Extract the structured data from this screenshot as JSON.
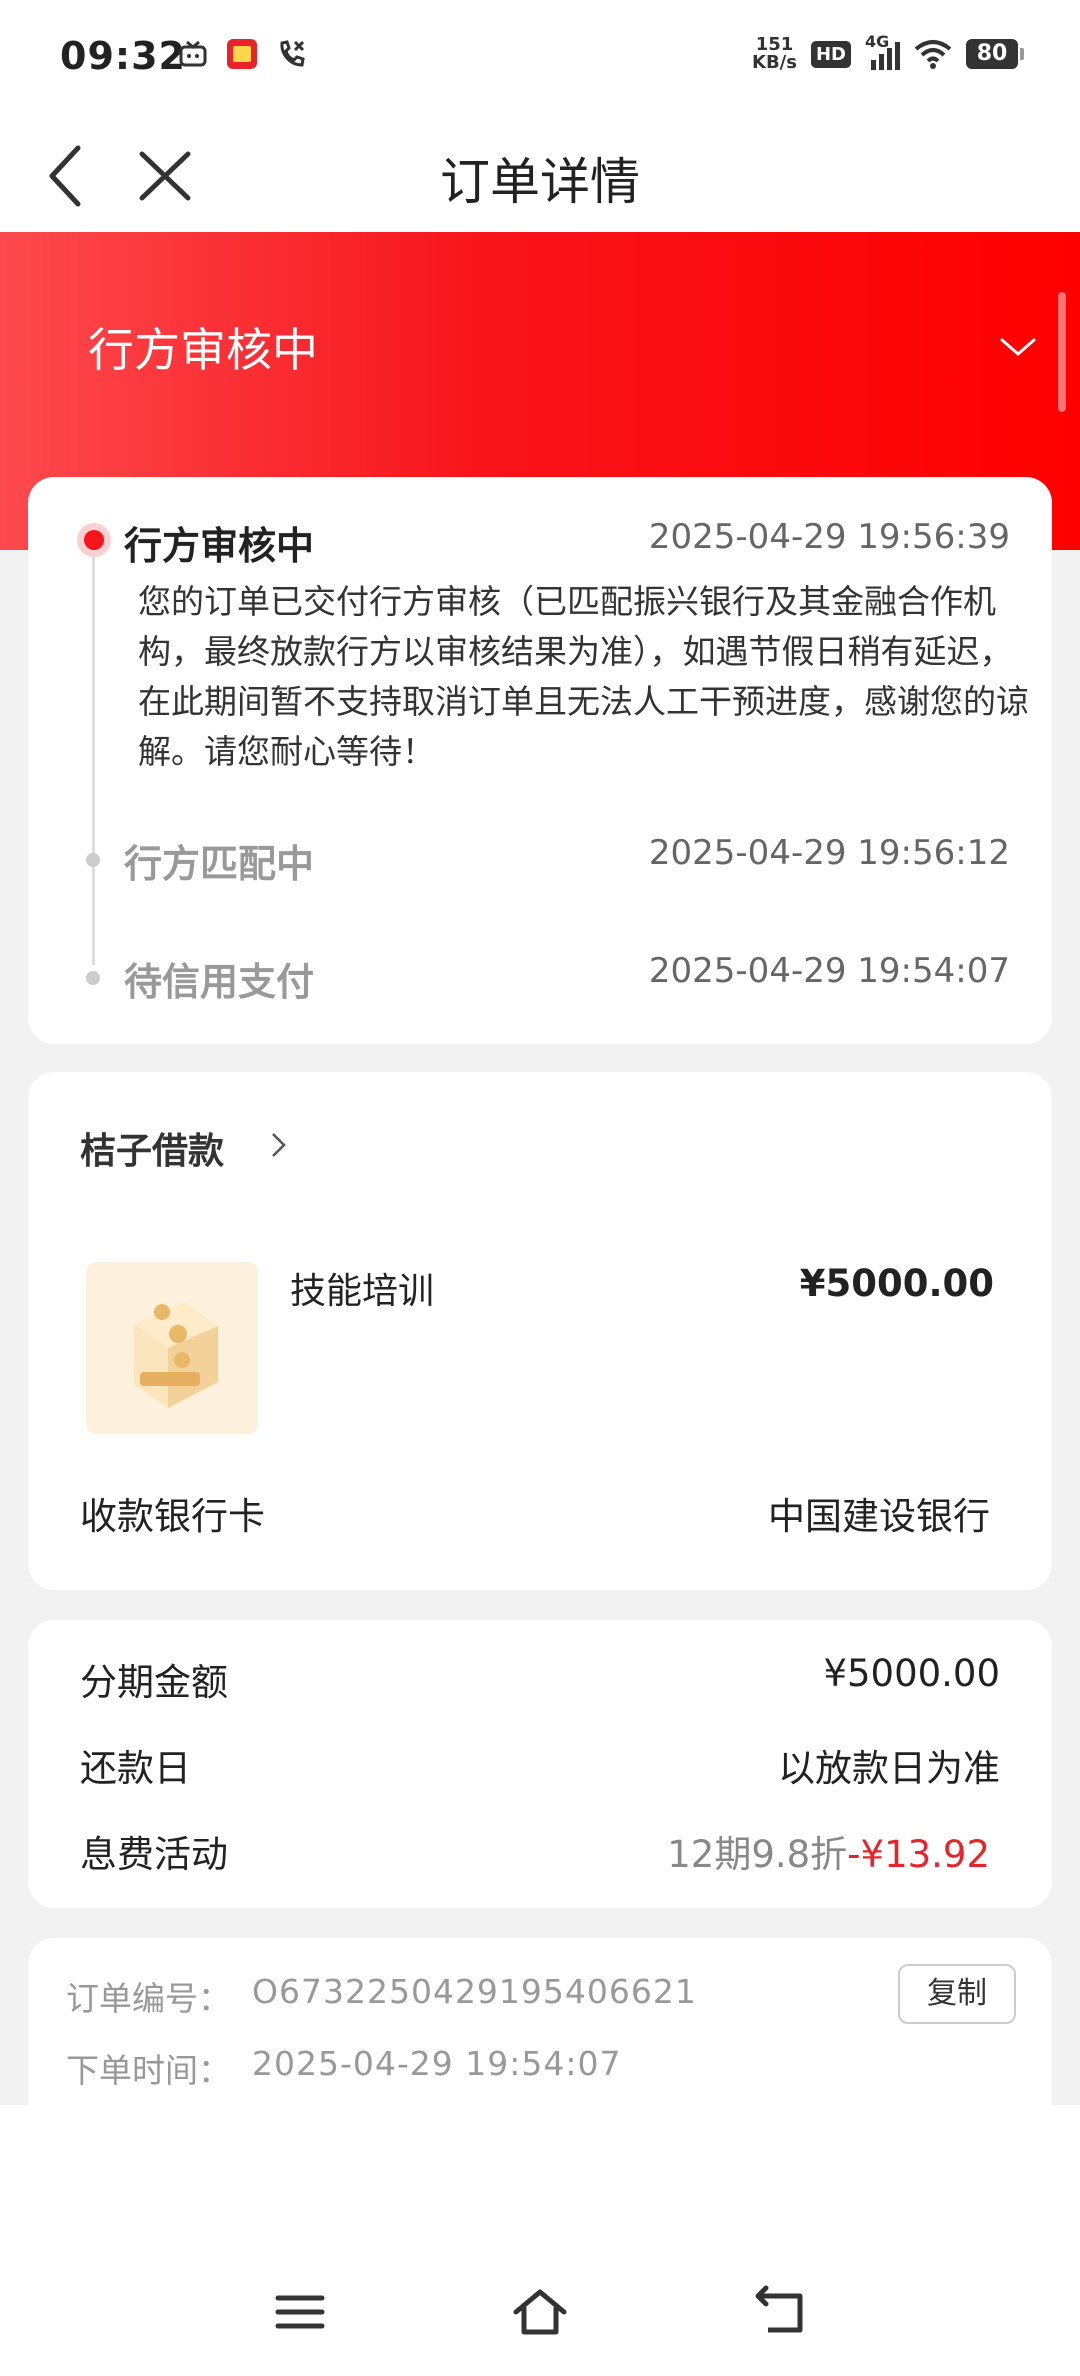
{
  "status_bar": {
    "time": "09:32",
    "speed_value": "151",
    "speed_unit": "KB/s",
    "hd": "HD",
    "network": "4G",
    "battery": "80"
  },
  "nav": {
    "title": "订单详情",
    "back_icon": "chevron-left-icon",
    "close_icon": "close-icon"
  },
  "header": {
    "status": "行方审核中"
  },
  "timeline": [
    {
      "title": "行方审核中",
      "time": "2025-04-29 19:56:39",
      "desc": "您的订单已交付行方审核（已匹配振兴银行及其金融合作机构，最终放款行方以审核结果为准），如遇节假日稍有延迟，在此期间暂不支持取消订单且无法人工干预进度，感谢您的谅解。请您耐心等待！"
    },
    {
      "title": "行方匹配中",
      "time": "2025-04-29 19:56:12"
    },
    {
      "title": "待信用支付",
      "time": "2025-04-29 19:54:07"
    }
  ],
  "product": {
    "shop": "桔子借款",
    "name": "技能培训",
    "price": "¥5000.00",
    "bank_label": "收款银行卡",
    "bank_value": "中国建设银行"
  },
  "installment": {
    "amount_label": "分期金额",
    "amount_value": "¥5000.00",
    "repay_label": "还款日",
    "repay_value": "以放款日为准",
    "fee_label": "息费活动",
    "fee_discount": "12期9.8折",
    "fee_saving": "-¥13.92"
  },
  "order_info": {
    "id_label": "订单编号：",
    "id_value": "O67322504291954066 21",
    "copy": "复制",
    "time_label": "下单时间：",
    "time_value": "2025-04-29 19:54:07"
  },
  "colors": {
    "accent": "#f5141b",
    "hero_start": "#fd4a4e",
    "hero_end": "#ff0000"
  }
}
